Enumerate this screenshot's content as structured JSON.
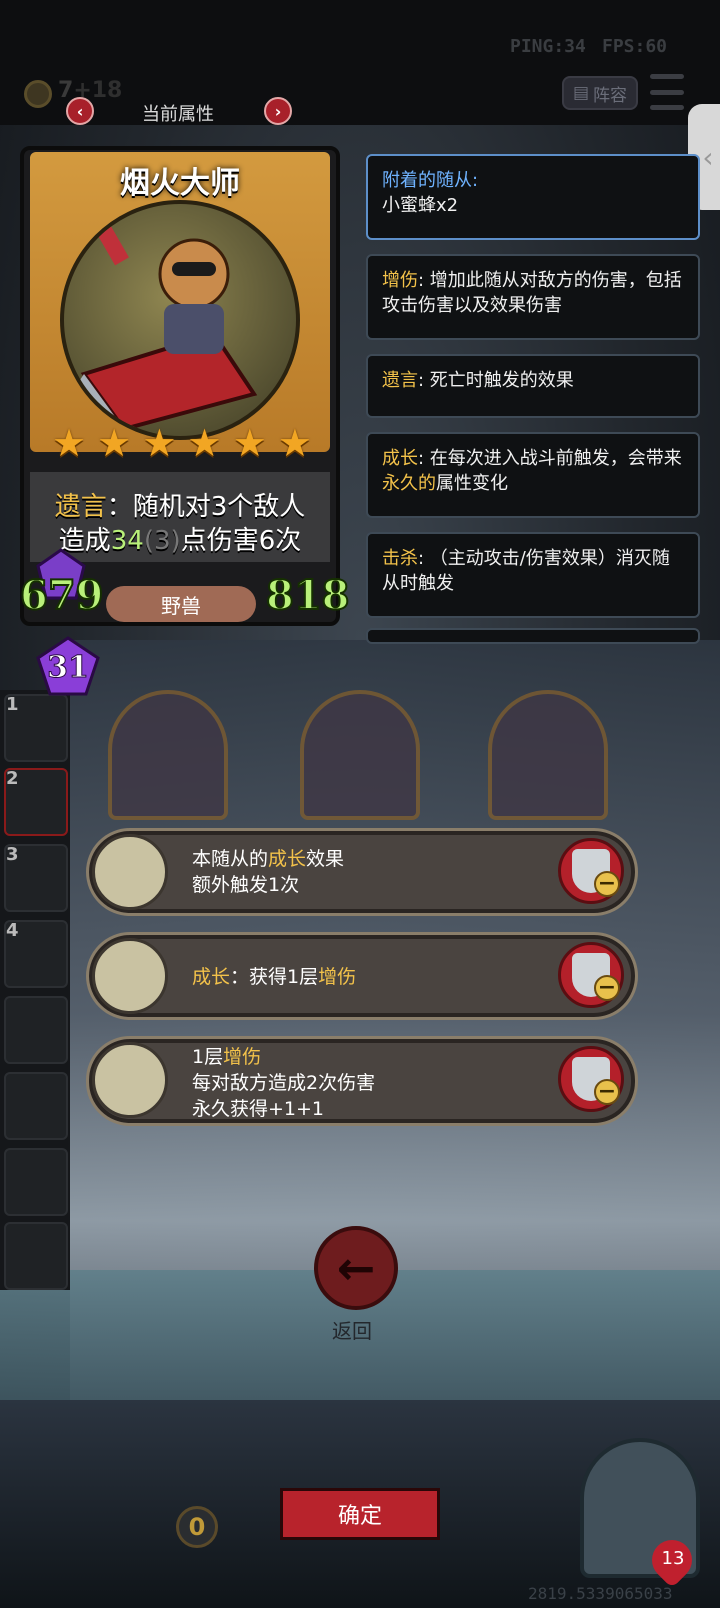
{
  "hud": {
    "ping": "PING:34",
    "fps": "FPS:60",
    "gold": "7",
    "gold_delta": "+18",
    "lineup_label": "阵容"
  },
  "header": {
    "current_attributes": "当前属性"
  },
  "card": {
    "name": "烟火大师",
    "stars": 6,
    "effect_keyword": "遗言",
    "effect_line1_rest": "：随机对3个敌人",
    "effect_line2_prefix": "造成",
    "damage": "34",
    "damage_base": "(3)",
    "effect_line2_suffix": "点伤害6次",
    "attack": "679",
    "health": "818",
    "tribe": "野兽",
    "level": "31"
  },
  "info_panels": [
    {
      "keyword": "附着的随从:",
      "text": "小蜜蜂x2"
    },
    {
      "keyword": "增伤",
      "text": ": 增加此随从对敌方的伤害，包括攻击伤害以及效果伤害"
    },
    {
      "keyword": "遗言",
      "text": ": 死亡时触发的效果"
    },
    {
      "keyword": "成长",
      "text_before": ": 在每次进入战斗前触发，会带来",
      "highlight": "永久的",
      "text_after": "属性变化"
    },
    {
      "keyword": "击杀",
      "text": ": （主动攻击/伤害效果）消灭随从时触发"
    }
  ],
  "roster": {
    "slots": [
      "1",
      "2",
      "3",
      "4"
    ]
  },
  "abilities": [
    {
      "line1_before": "本随从的",
      "line1_kw": "成长",
      "line1_after": "效果",
      "line2": "额外触发1次",
      "icon": "pocket-watch-icon"
    },
    {
      "kw": "成长",
      "text": "：获得1层",
      "kw2": "增伤",
      "icon": "green-crystal-icon"
    },
    {
      "line1_before": "1层",
      "line1_kw": "增伤",
      "line2": "每对敌方造成2次伤害",
      "line3": "永久获得+1+1",
      "icon": "hooded-figure-icon"
    }
  ],
  "back_label": "返回",
  "confirm_label": "确定",
  "cost": "0",
  "health_badge": "13",
  "coords": "2819.5339065033",
  "colors": {
    "keyword": "#f3c24a",
    "stat_green": "#b9f07a",
    "button_red": "#b8232c"
  }
}
